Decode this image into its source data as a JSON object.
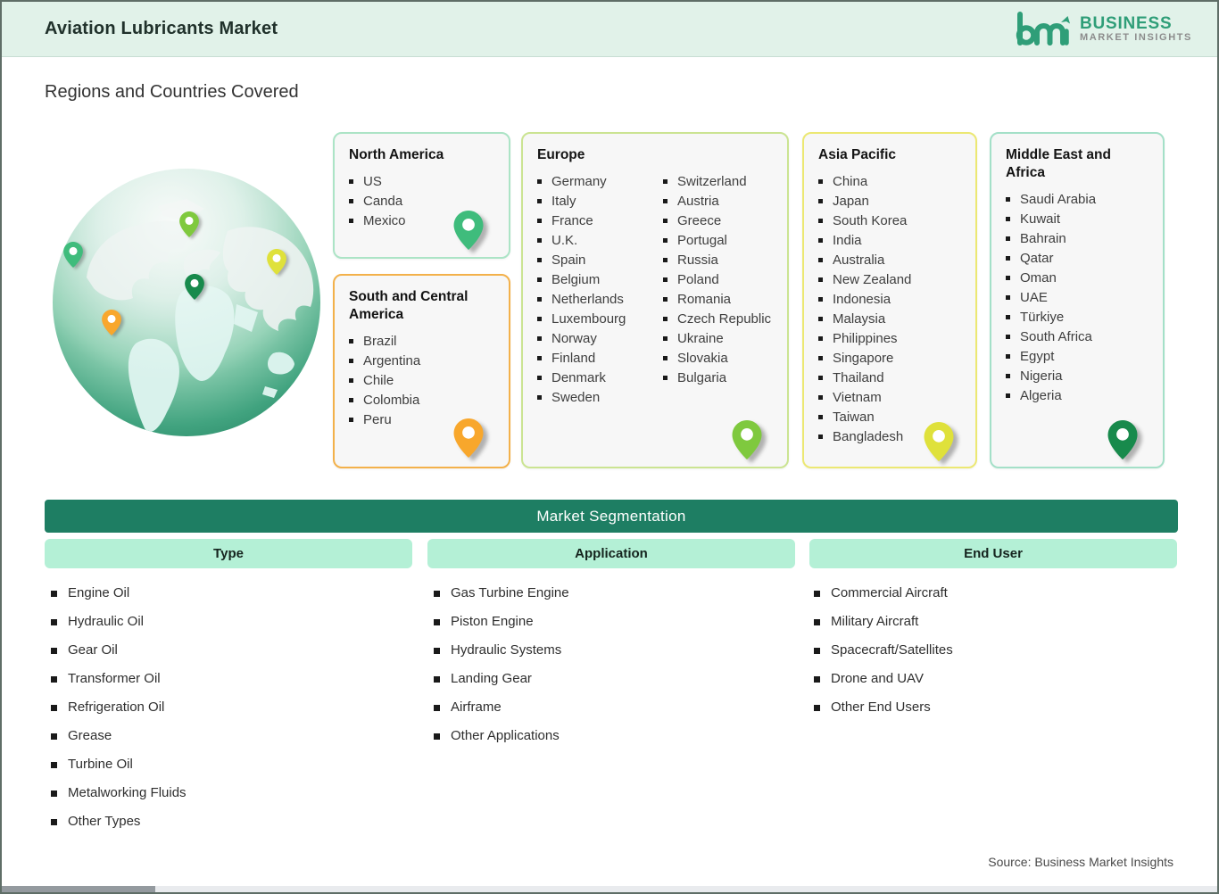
{
  "header": {
    "title": "Aviation Lubricants Market",
    "logo": {
      "mark": "bmi",
      "line1": "BUSINESS",
      "line2": "MARKET INSIGHTS"
    }
  },
  "section_title": "Regions and Countries Covered",
  "regions": [
    {
      "name": "North America",
      "countries": [
        "US",
        "Canda",
        "Mexico"
      ],
      "border_color": "#ace4c6",
      "pin_color": "#3fbc7c"
    },
    {
      "name": "South and Central America",
      "countries": [
        "Brazil",
        "Argentina",
        "Chile",
        "Colombia",
        "Peru"
      ],
      "border_color": "#f3b14b",
      "pin_color": "#f8a72c"
    },
    {
      "name": "Europe",
      "countries": [
        "Germany",
        "Italy",
        "France",
        "U.K.",
        "Spain",
        "Belgium",
        "Netherlands",
        "Luxembourg",
        "Norway",
        "Finland",
        "Denmark",
        "Sweden",
        "Switzerland",
        "Austria",
        "Greece",
        "Portugal",
        "Russia",
        "Poland",
        "Romania",
        "Czech Republic",
        "Ukraine",
        "Slovakia",
        "Bulgaria"
      ],
      "border_color": "#cbe492",
      "pin_color": "#7fc93e"
    },
    {
      "name": "Asia Pacific",
      "countries": [
        "China",
        "Japan",
        "South Korea",
        "India",
        "Australia",
        "New Zealand",
        "Indonesia",
        "Malaysia",
        "Philippines",
        "Singapore",
        "Thailand",
        "Vietnam",
        "Taiwan",
        "Bangladesh"
      ],
      "border_color": "#ece873",
      "pin_color": "#dfe13b"
    },
    {
      "name": "Middle East and Africa",
      "countries": [
        "Saudi Arabia",
        "Kuwait",
        "Bahrain",
        "Qatar",
        "Oman",
        "UAE",
        "Türkiye",
        "South Africa",
        "Egypt",
        "Nigeria",
        "Algeria"
      ],
      "border_color": "#a4e0c8",
      "pin_color": "#188a4c"
    }
  ],
  "segmentation": {
    "title": "Market Segmentation",
    "columns": [
      {
        "header": "Type",
        "items": [
          "Engine Oil",
          "Hydraulic Oil",
          "Gear Oil",
          "Transformer Oil",
          "Refrigeration Oil",
          "Grease",
          "Turbine Oil",
          "Metalworking Fluids",
          "Other Types"
        ]
      },
      {
        "header": "Application",
        "items": [
          "Gas Turbine Engine",
          "Piston Engine",
          "Hydraulic Systems",
          "Landing Gear",
          "Airframe",
          "Other Applications"
        ]
      },
      {
        "header": "End User",
        "items": [
          "Commercial Aircraft",
          "Military Aircraft",
          "Spacecraft/Satellites",
          "Drone and UAV",
          "Other End Users"
        ]
      }
    ]
  },
  "source": "Source: Business Market Insights",
  "colors": {
    "band": "#e1f2e9",
    "bar_green": "#1e7e63",
    "mint": "#b4f0d6",
    "logo_green": "#2f9e78",
    "logo_gray": "#8c8c8c"
  }
}
